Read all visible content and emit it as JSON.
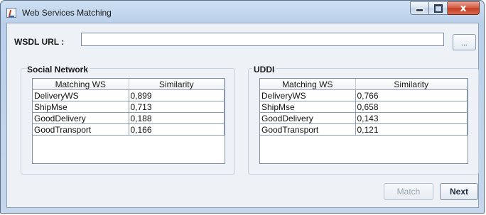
{
  "window": {
    "title": "Web Services Matching",
    "icons": {
      "app": "java-app-icon",
      "minimize": "minimize-icon",
      "maximize": "maximize-icon",
      "close": "close-icon"
    },
    "close_glyph": "x"
  },
  "form": {
    "url_label": "WSDL URL :",
    "url_value": "",
    "browse_label": "..."
  },
  "social": {
    "title": "Social Network",
    "columns": [
      "Matching WS",
      "Similarity"
    ],
    "rows": [
      [
        "DeliveryWS",
        "0,899"
      ],
      [
        "ShipMse",
        "0,713"
      ],
      [
        "GoodDelivery",
        "0,188"
      ],
      [
        "GoodTransport",
        "0,166"
      ]
    ]
  },
  "uddi": {
    "title": "UDDI",
    "columns": [
      "Matching WS",
      "Similarity"
    ],
    "rows": [
      [
        "DeliveryWS",
        "0,766"
      ],
      [
        "ShipMse",
        "0,658"
      ],
      [
        "GoodDelivery",
        "0,143"
      ],
      [
        "GoodTransport",
        "0,121"
      ]
    ]
  },
  "actions": {
    "match_label": "Match",
    "next_label": "Next"
  },
  "colors": {
    "title_bar": "#c3d6ee",
    "close_button": "#c9452a",
    "content_bg": "#eef2f7",
    "disabled_text": "#9aa4b1"
  }
}
